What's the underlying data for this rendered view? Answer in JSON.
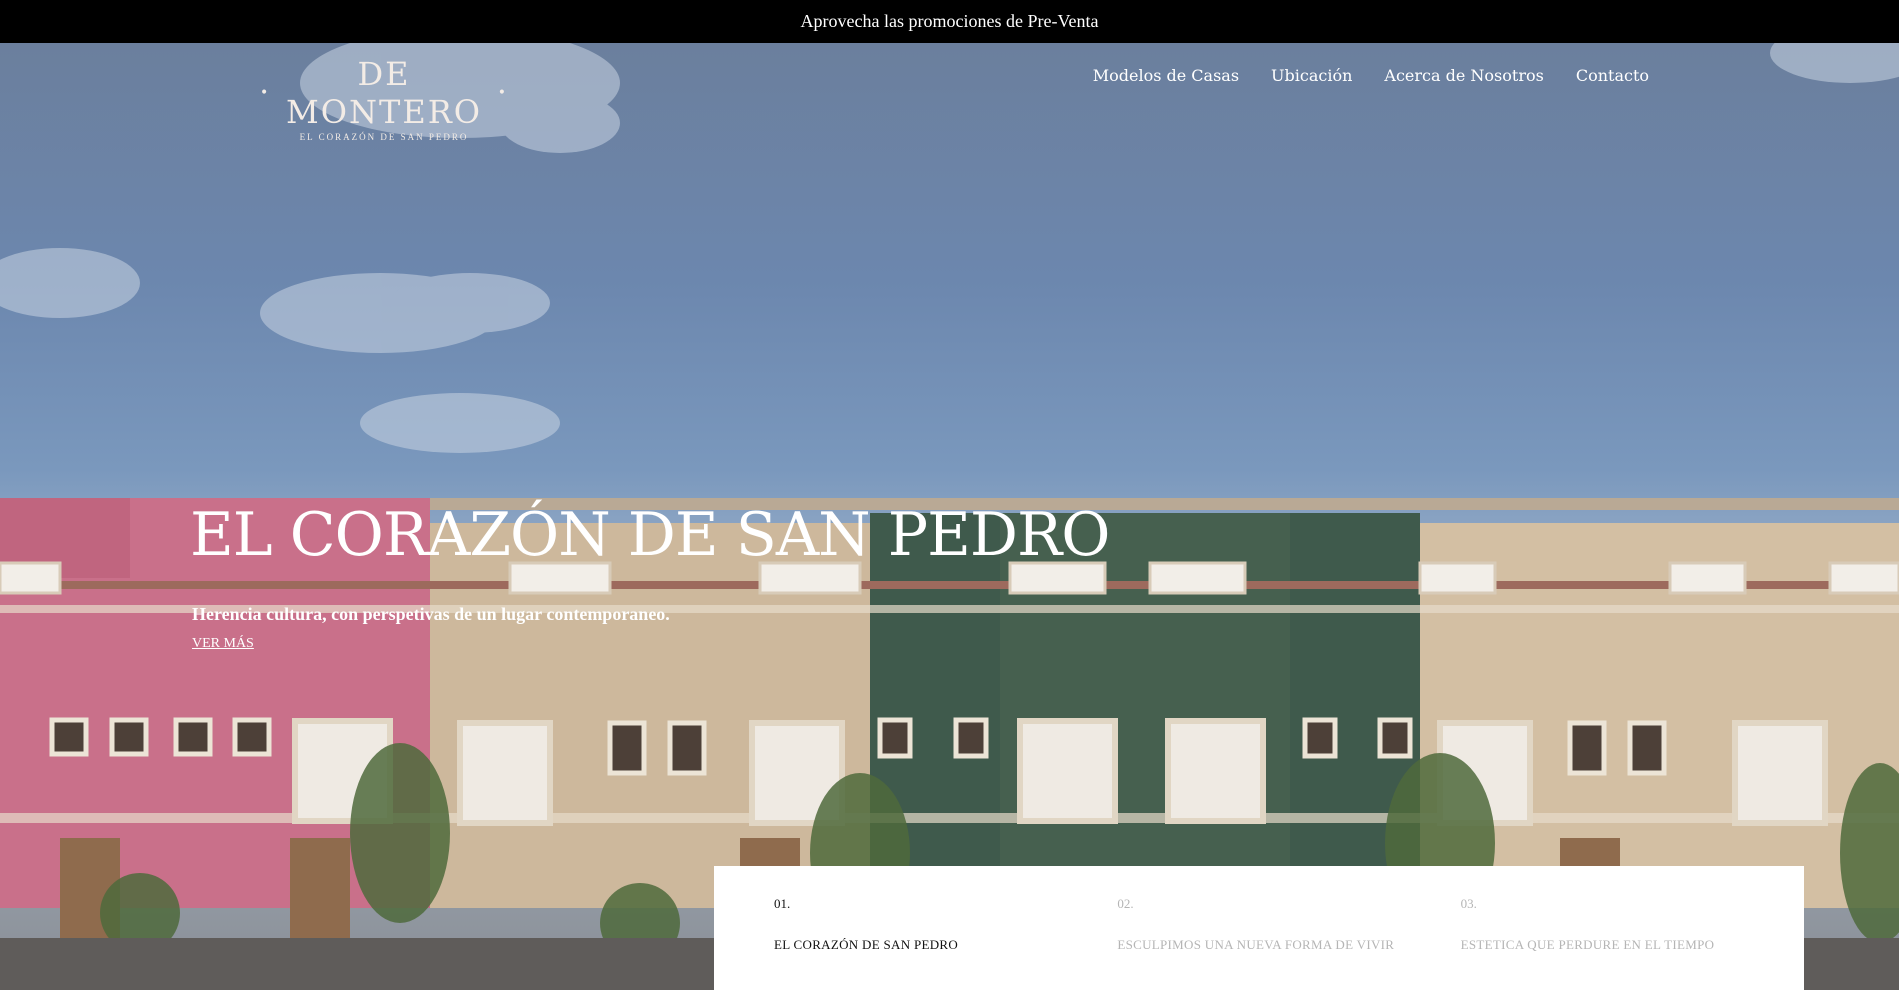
{
  "promo": {
    "text": "Aprovecha las promociones de Pre-Venta"
  },
  "logo": {
    "main": "DE MONTERO",
    "sub": "EL CORAZÓN DE SAN PEDRO"
  },
  "nav": {
    "items": [
      {
        "label": "Modelos de Casas"
      },
      {
        "label": "Ubicación"
      },
      {
        "label": "Acerca de Nosotros"
      },
      {
        "label": "Contacto"
      }
    ]
  },
  "hero": {
    "title": "EL CORAZÓN DE SAN PEDRO",
    "subtitle": "Herencia cultura, con perspetivas de un lugar contemporaneo.",
    "cta": "VER MÁS"
  },
  "tabs": [
    {
      "num": "01.",
      "label": "EL CORAZÓN DE SAN PEDRO",
      "active": true
    },
    {
      "num": "02.",
      "label": "ESCULPIMOS UNA NUEVA FORMA DE VIVIR",
      "active": false
    },
    {
      "num": "03.",
      "label": "ESTETICA QUE PERDURE EN EL TIEMPO",
      "active": false
    }
  ],
  "colors": {
    "promo_bg": "#000000",
    "facade_pink": "#c9708a",
    "facade_beige": "#cdb89c",
    "facade_green": "#3f5a4c"
  }
}
